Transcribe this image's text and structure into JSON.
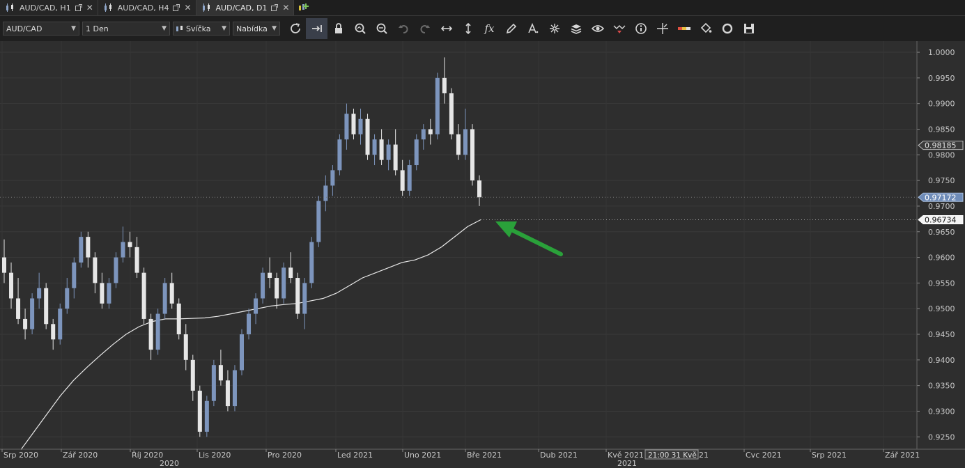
{
  "tabs": [
    {
      "label": "AUD/CAD, H1",
      "active": false
    },
    {
      "label": "AUD/CAD, H4",
      "active": false
    },
    {
      "label": "AUD/CAD, D1",
      "active": true
    }
  ],
  "toolbar": {
    "symbol": "AUD/CAD",
    "period": "1 Den",
    "chart_type": "Svíčka",
    "price_side": "Nabídka",
    "icons": [
      "refresh-icon",
      "scroll-right-icon",
      "lock-icon",
      "zoom-in-icon",
      "zoom-out-icon",
      "undo-icon",
      "redo-icon",
      "stretch-horizontal-icon",
      "stretch-vertical-icon",
      "indicators-fx-icon",
      "pencil-icon",
      "text-tool-icon",
      "crosshair-tool-icon",
      "layers-icon",
      "eye-icon",
      "signal-icon",
      "info-icon",
      "cursor-cross-icon",
      "color-bar-icon",
      "paint-bucket-icon",
      "cycle-icon",
      "save-icon"
    ]
  },
  "chart_data": {
    "type": "candlestick",
    "symbol": "AUD/CAD",
    "period": "D1",
    "title": "",
    "ylim": [
      0.923,
      1.0015
    ],
    "y_ticks": [
      "1.0000",
      "0.9950",
      "0.9900",
      "0.9850",
      "0.9800",
      "0.9750",
      "0.9700",
      "0.9650",
      "0.9600",
      "0.9550",
      "0.9500",
      "0.9450",
      "0.9400",
      "0.9350",
      "0.9300",
      "0.9250"
    ],
    "x_month_labels": [
      "Srp 2020",
      "Zář 2020",
      "Říj 2020",
      "Lis 2020",
      "Pro 2020",
      "Led 2021",
      "Uno 2021",
      "Bře 2021",
      "Dub 2021",
      "Kvě 2021",
      "Cvc 2021",
      "Srp 2021",
      "Zář 2021"
    ],
    "x_label_partial": "21",
    "x_year_labels": [
      "2020",
      "2021"
    ],
    "crosshair_time": "21:00 31 Kvě",
    "price_labels": {
      "level_1": "0.98185",
      "current": "0.97172",
      "ma_value": "0.96734"
    },
    "ma_series_name": "",
    "ma_values": [
      0.9225,
      0.926,
      0.9295,
      0.933,
      0.936,
      0.9385,
      0.9408,
      0.943,
      0.945,
      0.9465,
      0.9475,
      0.948,
      0.948,
      0.9481,
      0.9482,
      0.9485,
      0.949,
      0.9495,
      0.95,
      0.9505,
      0.9508,
      0.951,
      0.9515,
      0.952,
      0.953,
      0.9545,
      0.956,
      0.957,
      0.958,
      0.959,
      0.9595,
      0.9605,
      0.962,
      0.964,
      0.966,
      0.96734
    ],
    "ohlc": [
      [
        0.96,
        0.9635,
        0.955,
        0.957
      ],
      [
        0.957,
        0.959,
        0.95,
        0.952
      ],
      [
        0.952,
        0.956,
        0.947,
        0.948
      ],
      [
        0.948,
        0.95,
        0.944,
        0.946
      ],
      [
        0.946,
        0.953,
        0.945,
        0.952
      ],
      [
        0.952,
        0.957,
        0.95,
        0.954
      ],
      [
        0.954,
        0.955,
        0.946,
        0.947
      ],
      [
        0.947,
        0.948,
        0.942,
        0.944
      ],
      [
        0.944,
        0.951,
        0.943,
        0.95
      ],
      [
        0.95,
        0.956,
        0.949,
        0.954
      ],
      [
        0.954,
        0.96,
        0.952,
        0.959
      ],
      [
        0.959,
        0.965,
        0.958,
        0.964
      ],
      [
        0.964,
        0.965,
        0.958,
        0.96
      ],
      [
        0.96,
        0.961,
        0.953,
        0.955
      ],
      [
        0.955,
        0.957,
        0.95,
        0.951
      ],
      [
        0.951,
        0.956,
        0.95,
        0.955
      ],
      [
        0.955,
        0.961,
        0.954,
        0.96
      ],
      [
        0.96,
        0.966,
        0.959,
        0.963
      ],
      [
        0.963,
        0.965,
        0.96,
        0.962
      ],
      [
        0.962,
        0.964,
        0.956,
        0.957
      ],
      [
        0.957,
        0.958,
        0.947,
        0.948
      ],
      [
        0.948,
        0.949,
        0.94,
        0.942
      ],
      [
        0.942,
        0.95,
        0.941,
        0.949
      ],
      [
        0.949,
        0.956,
        0.948,
        0.955
      ],
      [
        0.955,
        0.957,
        0.95,
        0.951
      ],
      [
        0.951,
        0.952,
        0.944,
        0.945
      ],
      [
        0.945,
        0.947,
        0.938,
        0.94
      ],
      [
        0.94,
        0.941,
        0.932,
        0.934
      ],
      [
        0.934,
        0.935,
        0.925,
        0.926
      ],
      [
        0.926,
        0.933,
        0.925,
        0.932
      ],
      [
        0.932,
        0.94,
        0.931,
        0.939
      ],
      [
        0.939,
        0.942,
        0.935,
        0.936
      ],
      [
        0.936,
        0.938,
        0.93,
        0.931
      ],
      [
        0.931,
        0.939,
        0.93,
        0.938
      ],
      [
        0.938,
        0.946,
        0.937,
        0.945
      ],
      [
        0.945,
        0.95,
        0.944,
        0.949
      ],
      [
        0.949,
        0.953,
        0.947,
        0.952
      ],
      [
        0.952,
        0.958,
        0.951,
        0.957
      ],
      [
        0.957,
        0.96,
        0.954,
        0.956
      ],
      [
        0.956,
        0.957,
        0.95,
        0.952
      ],
      [
        0.952,
        0.959,
        0.951,
        0.958
      ],
      [
        0.958,
        0.961,
        0.955,
        0.956
      ],
      [
        0.956,
        0.957,
        0.948,
        0.949
      ],
      [
        0.949,
        0.956,
        0.946,
        0.955
      ],
      [
        0.955,
        0.964,
        0.954,
        0.963
      ],
      [
        0.963,
        0.972,
        0.962,
        0.971
      ],
      [
        0.971,
        0.976,
        0.969,
        0.974
      ],
      [
        0.974,
        0.978,
        0.972,
        0.977
      ],
      [
        0.977,
        0.984,
        0.976,
        0.983
      ],
      [
        0.983,
        0.99,
        0.981,
        0.988
      ],
      [
        0.988,
        0.989,
        0.983,
        0.984
      ],
      [
        0.984,
        0.989,
        0.982,
        0.987
      ],
      [
        0.987,
        0.988,
        0.979,
        0.98
      ],
      [
        0.98,
        0.984,
        0.978,
        0.983
      ],
      [
        0.983,
        0.985,
        0.978,
        0.979
      ],
      [
        0.979,
        0.983,
        0.977,
        0.982
      ],
      [
        0.982,
        0.985,
        0.976,
        0.977
      ],
      [
        0.977,
        0.979,
        0.972,
        0.973
      ],
      [
        0.973,
        0.979,
        0.972,
        0.978
      ],
      [
        0.978,
        0.984,
        0.977,
        0.983
      ],
      [
        0.983,
        0.986,
        0.981,
        0.985
      ],
      [
        0.985,
        0.987,
        0.982,
        0.984
      ],
      [
        0.984,
        0.996,
        0.983,
        0.995
      ],
      [
        0.995,
        0.999,
        0.99,
        0.992
      ],
      [
        0.992,
        0.993,
        0.983,
        0.984
      ],
      [
        0.984,
        0.986,
        0.979,
        0.98
      ],
      [
        0.98,
        0.989,
        0.979,
        0.985
      ],
      [
        0.985,
        0.986,
        0.974,
        0.975
      ],
      [
        0.975,
        0.976,
        0.97,
        0.97172
      ]
    ]
  }
}
